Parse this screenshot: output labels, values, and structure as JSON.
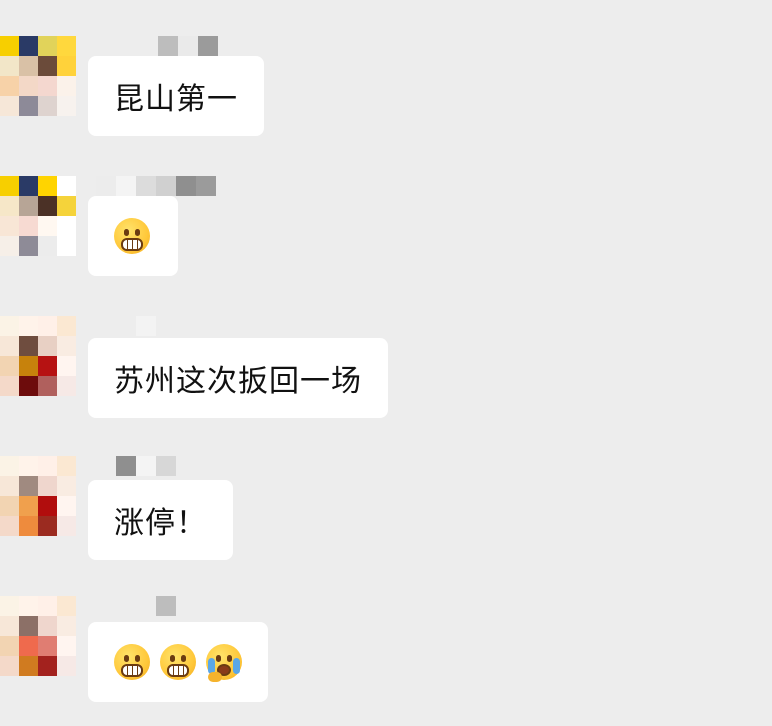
{
  "chat": {
    "messages": [
      {
        "text": "昆山第一"
      },
      {
        "emoji": [
          "grin"
        ]
      },
      {
        "text": "苏州这次扳回一场"
      },
      {
        "text": "涨停！"
      },
      {
        "emoji": [
          "grin",
          "grin",
          "laugh-cry"
        ]
      }
    ]
  },
  "colors": {
    "background": "#ededed",
    "bubble": "#ffffff",
    "text": "#111111"
  }
}
